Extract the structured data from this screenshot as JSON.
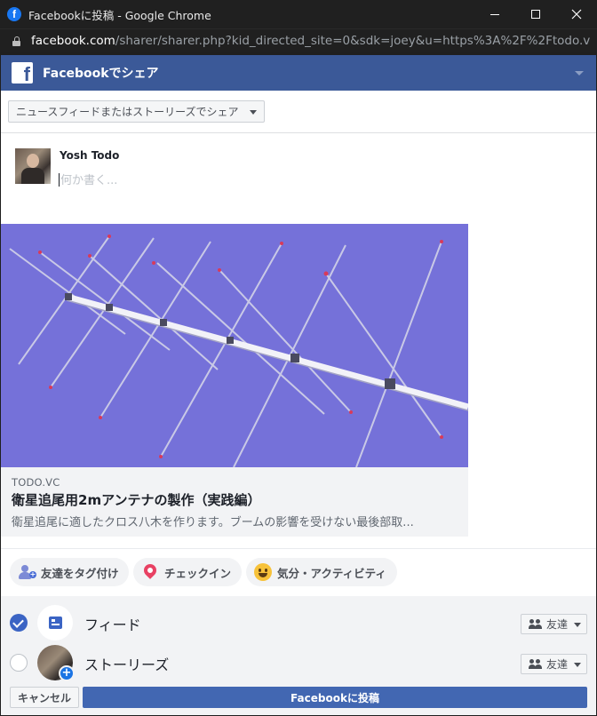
{
  "window": {
    "title": "Facebookに投稿 - Google Chrome",
    "favicon": "facebook-icon"
  },
  "address": {
    "host": "facebook.com",
    "path": "/sharer/sharer.php?kid_directed_site=0&sdk=joey&u=https%3A%2F%2Ftodo.vc%2F..."
  },
  "header": {
    "title": "Facebookでシェア",
    "color": "#3b5998"
  },
  "share_target": {
    "selected": "ニュースフィードまたはストーリーズでシェア"
  },
  "composer": {
    "user_name": "Yosh Todo",
    "placeholder": "何か書く..."
  },
  "link_preview": {
    "domain": "TODO.VC",
    "title": "衛星追尾用2mアンテナの製作（実践編）",
    "description": "衛星追尾に適したクロス八木を作ります。ブームの影響を受けない最後部取..."
  },
  "actions": {
    "tag_friends": "友達をタグ付け",
    "check_in": "チェックイン",
    "feeling": "気分・アクティビティ"
  },
  "destinations": [
    {
      "label": "フィード",
      "checked": true,
      "audience": "友達"
    },
    {
      "label": "ストーリーズ",
      "checked": false,
      "audience": "友達"
    }
  ],
  "footer": {
    "cancel_label": "キャンセル",
    "post_label": "Facebookに投稿",
    "post_color": "#4267b2"
  }
}
